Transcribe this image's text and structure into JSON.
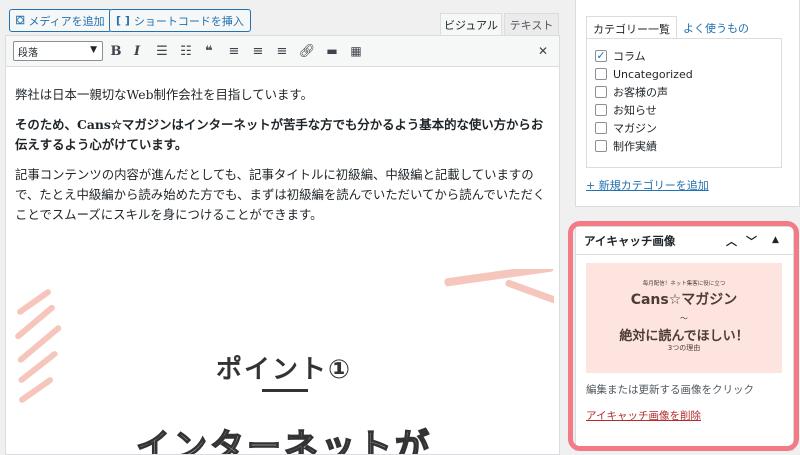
{
  "media": {
    "add_media_label": "メディアを追加",
    "shortcode_label": "ショートコードを挿入"
  },
  "editor_tabs": [
    {
      "label": "ビジュアル"
    },
    {
      "label": "テキスト"
    }
  ],
  "toolbar": {
    "format_value": "段落",
    "buttons": [
      "bold-icon",
      "italic-icon",
      "bulleted-list-icon",
      "numbered-list-icon",
      "blockquote-icon",
      "align-left-icon",
      "align-center-icon",
      "align-right-icon",
      "link-icon",
      "read-more-icon",
      "toolbar-toggle-icon",
      "fullscreen-icon"
    ]
  },
  "content": {
    "p1": "弊社は日本一親切なWeb制作会社を目指しています。",
    "p2": "そのため、Cans☆マガジンはインターネットが苦手な方でも分かるよう基本的な使い方からお伝えするよう心がけています。",
    "p3": "記事コンテンツの内容が進んだとしても、記事タイトルに初級編、中級編と記載していますので、たとえ中級編から読み始めた方でも、まずは初級編を読んでいただいてから読んでいただくことでスムーズにスキルを身につけることができます。",
    "image_title": "ポイント①",
    "image_big": "インターネットが"
  },
  "category": {
    "tab_all": "カテゴリー一覧",
    "tab_popular": "よく使うもの",
    "items": [
      {
        "label": "コラム",
        "checked": true
      },
      {
        "label": "Uncategorized",
        "checked": false
      },
      {
        "label": "お客様の声",
        "checked": false
      },
      {
        "label": "お知らせ",
        "checked": false
      },
      {
        "label": "マガジン",
        "checked": false
      },
      {
        "label": "制作実績",
        "checked": false
      }
    ],
    "add_new_label": "+ 新規カテゴリーを追加"
  },
  "featured": {
    "title": "アイキャッチ画像",
    "thumb_line1": "毎月配信！ネット集客に役に立つ",
    "thumb_line2": "Cans☆マガジン",
    "thumb_line3": "〜",
    "thumb_line4": "絶対に読んでほしい！",
    "thumb_line5": "3つの理由",
    "help_text": "編集または更新する画像をクリック",
    "remove_label": "アイキャッチ画像を削除"
  },
  "colors": {
    "accent": "#2271b1",
    "highlight": "#f27b86",
    "danger": "#b32d2e",
    "thumb_bg": "#fde4de"
  }
}
